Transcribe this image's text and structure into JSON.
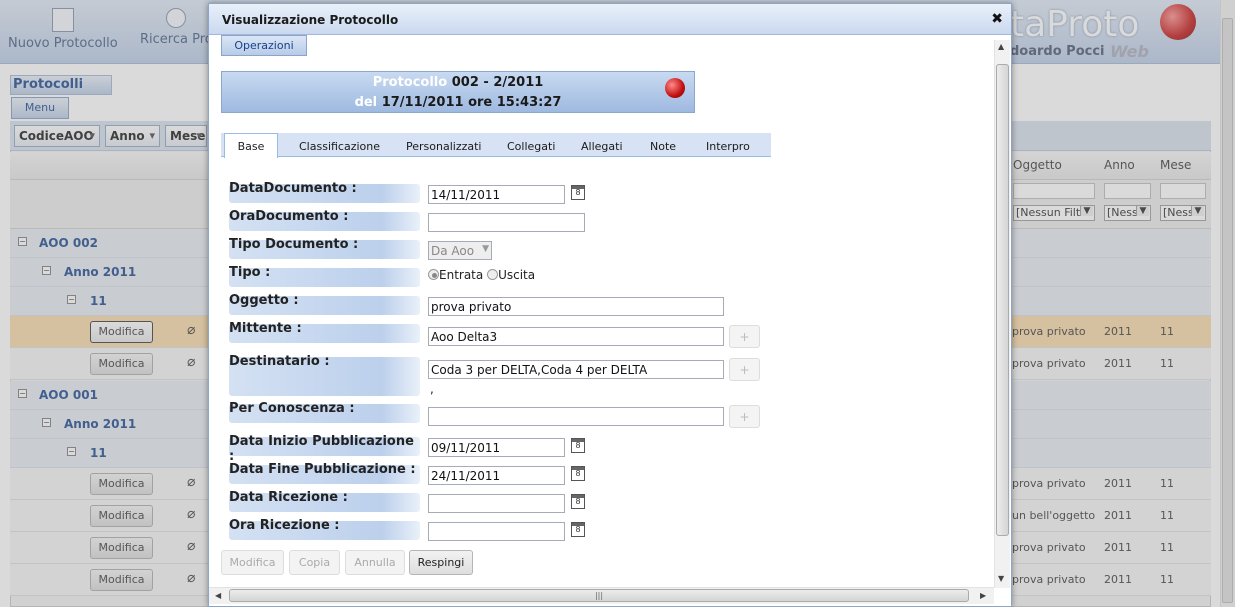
{
  "app": {
    "toolbar": [
      {
        "label": "Nuovo Protocollo",
        "icon": "new-document-icon"
      },
      {
        "label": "Ricerca Pro",
        "icon": "search-icon"
      }
    ],
    "brand": {
      "text": "taProto",
      "sub": "doardo Pocci",
      "web": "Web"
    }
  },
  "left_panel": {
    "title": "Protocolli",
    "menu": "Menu"
  },
  "grid": {
    "group_combos": [
      "CodiceAOO",
      "Anno",
      "Mese"
    ],
    "columns_right": [
      "Oggetto",
      "Anno",
      "Mese"
    ],
    "filter_options": [
      "[Nessun Filtr",
      "[Ness",
      "[Ness"
    ],
    "groups": [
      {
        "aoo": "AOO 002",
        "anno": "Anno 2011",
        "mese": "11"
      },
      {
        "aoo": "AOO 001",
        "anno": "Anno 2011",
        "mese": "11"
      }
    ],
    "rows_group1": [
      {
        "btn": "Modifica",
        "oggetto": "prova privato",
        "anno": "2011",
        "mese": "11",
        "selected": true
      },
      {
        "btn": "Modifica",
        "oggetto": "prova privato",
        "anno": "2011",
        "mese": "11",
        "selected": false
      }
    ],
    "rows_group2": [
      {
        "btn": "Modifica",
        "oggetto": "prova privato",
        "anno": "2011",
        "mese": "11"
      },
      {
        "btn": "Modifica",
        "oggetto": "un bell'oggetto",
        "anno": "2011",
        "mese": "11"
      },
      {
        "btn": "Modifica",
        "oggetto": "prova privato",
        "anno": "2011",
        "mese": "11"
      },
      {
        "btn": "Modifica",
        "oggetto": "prova privato",
        "anno": "2011",
        "mese": "11"
      }
    ]
  },
  "dialog": {
    "title": "Visualizzazione Protocollo",
    "operations": "Operazioni",
    "protocol": {
      "label_protocollo": "Protocollo",
      "number": "002 - 2/2011",
      "label_del": "del",
      "datetime": "17/11/2011 ore 15:43:27"
    },
    "tabs": [
      "Base",
      "Classificazione",
      "Personalizzati",
      "Collegati",
      "Allegati",
      "Note",
      "Interpro"
    ],
    "fields": {
      "data_documento": {
        "label": "DataDocumento :",
        "value": "14/11/2011"
      },
      "ora_documento": {
        "label": "OraDocumento :",
        "value": ""
      },
      "tipo_documento": {
        "label": "Tipo Documento :",
        "value": "Da Aoo"
      },
      "tipo": {
        "label": "Tipo :",
        "opt1": "Entrata",
        "opt2": "Uscita"
      },
      "oggetto": {
        "label": "Oggetto :",
        "value": "prova privato"
      },
      "mittente": {
        "label": "Mittente :",
        "value": "Aoo Delta3"
      },
      "destinatario": {
        "label": "Destinatario :",
        "value": "Coda 3 per DELTA,Coda 4 per DELTA",
        "extra": ","
      },
      "per_conoscenza": {
        "label": "Per Conoscenza :",
        "value": ""
      },
      "data_inizio_pubblicazione": {
        "label": "Data Inizio Pubblicazione :",
        "value": "09/11/2011"
      },
      "data_fine_pubblicazione": {
        "label": "Data Fine Pubblicazione :",
        "value": "24/11/2011"
      },
      "data_ricezione": {
        "label": "Data Ricezione :",
        "value": ""
      },
      "ora_ricezione": {
        "label": "Ora Ricezione :",
        "value": ""
      }
    },
    "plus": "+",
    "buttons": {
      "modifica": "Modifica",
      "copia": "Copia",
      "annulla": "Annulla",
      "respingi": "Respingi"
    }
  },
  "colors": {
    "accent": "#15428b",
    "selected_row": "#f7d8a5",
    "header_blue": "#c9daf1"
  }
}
